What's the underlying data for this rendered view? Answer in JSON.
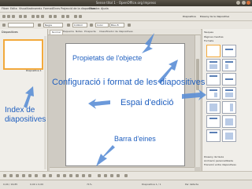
{
  "window": {
    "title": "Sense títol 1 - OpenOffice.org Impress"
  },
  "menu": [
    "Fitxer",
    "Edita",
    "Visualitza",
    "Insereix",
    "Format",
    "Eines",
    "Projecció de la diapositiva",
    "Finestra",
    "Ajuda"
  ],
  "toolbar": {
    "font_name": "Negre",
    "line_width": "0,00cm",
    "fill_color": "Blau 8",
    "area_label": "Color"
  },
  "slides_panel": {
    "title": "Diapositives",
    "slide_label": "Diapositiva 1"
  },
  "tabs": [
    "Normal",
    "Esquema",
    "Notes",
    "Prospecte",
    "Classificador de diapositives"
  ],
  "tasks_panel": {
    "header_items": [
      "Diapositiva",
      "Disseny de la diapositiva"
    ],
    "title": "Tasques",
    "sections": [
      "Pàgines mestres",
      "Formats"
    ],
    "bottom_sections": [
      "Disseny de taula",
      "Animació personalitzada",
      "Transició entre diapositives"
    ]
  },
  "statusbar": {
    "position": "0,00 / 16,85",
    "size": "0,00 x 0,00",
    "zoom": "71%",
    "page": "Diapositiva 1 / 1",
    "layout": "Per defecte"
  },
  "annotations": {
    "properties": "Propietats de l'objecte",
    "config": "Configuració i format de les diapositives",
    "edit_space": "Espai d'edició",
    "index": "Index de diapositives",
    "toolbar": "Barra d'eines"
  },
  "colors": {
    "accent": "#1f5fbf",
    "arrow": "#5b8fd6",
    "selection": "#f2a93c"
  }
}
